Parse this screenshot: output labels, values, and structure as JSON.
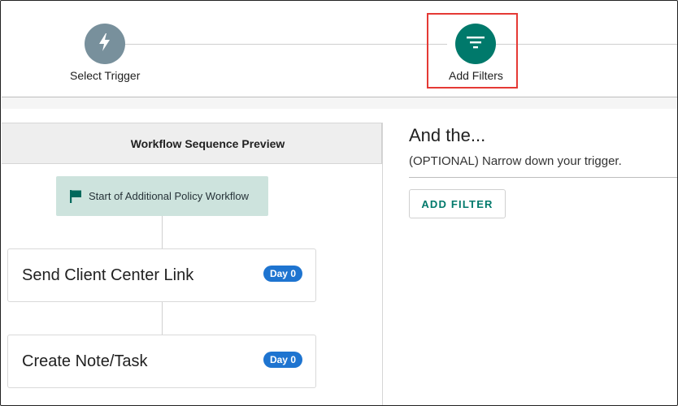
{
  "colors": {
    "step_inactive": "#78909c",
    "step_active": "#00796b",
    "highlight": "#e53935",
    "start_node_bg": "#cde3dd",
    "badge": "#1e74d0",
    "accent": "#00796b"
  },
  "stepper": {
    "steps": [
      {
        "label": "Select Trigger",
        "icon": "lightning-bolt-icon",
        "state": "inactive"
      },
      {
        "label": "Add Filters",
        "icon": "filter-icon",
        "state": "active"
      }
    ]
  },
  "preview": {
    "header": "Workflow Sequence Preview",
    "start_node": {
      "icon": "flag-icon",
      "label": "Start of Additional Policy Workflow"
    },
    "cards": [
      {
        "title": "Send Client Center Link",
        "badge": "Day 0"
      },
      {
        "title": "Create Note/Task",
        "badge": "Day 0"
      }
    ]
  },
  "filters": {
    "heading": "And the...",
    "description": "(OPTIONAL) Narrow down your trigger.",
    "add_button_label": "ADD FILTER"
  }
}
